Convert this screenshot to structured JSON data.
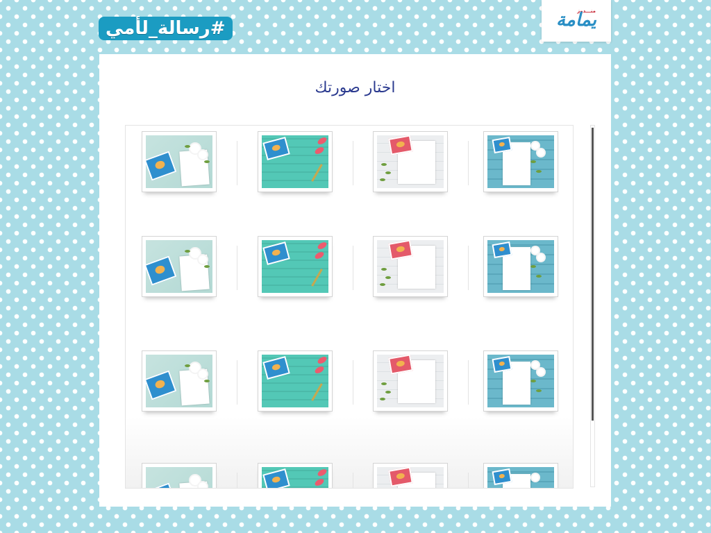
{
  "header": {
    "hashtag": "#رسالة_لأمي",
    "logo_text": "يمامة",
    "logo_subtext": "منـــدوز"
  },
  "main": {
    "title": "اختار صورتك"
  },
  "gallery": {
    "thumbnails": [
      "flowers-card-image",
      "turquoise-wood-image",
      "notebook-branches-image",
      "white-flowers-bouquet-image"
    ],
    "rows_visible": 4
  },
  "colors": {
    "background": "#a9dce6",
    "hashtag_bg": "#1b9cc2",
    "title": "#2b3a8f",
    "logo": "#2a8fc5"
  }
}
